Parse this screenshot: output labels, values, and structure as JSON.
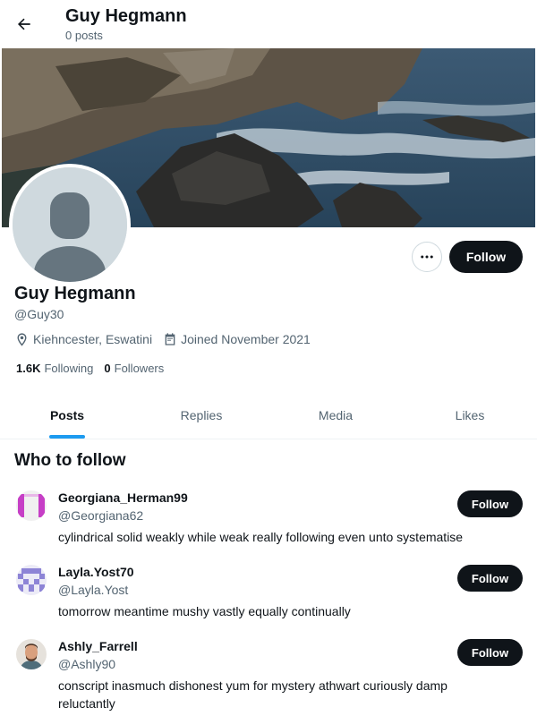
{
  "header": {
    "title": "Guy Hegmann",
    "subtitle": "0 posts"
  },
  "profile": {
    "name": "Guy Hegmann",
    "handle": "@Guy30",
    "location": "Kiehncester, Eswatini",
    "joined": "Joined November 2021",
    "following_count": "1.6K",
    "following_label": "Following",
    "followers_count": "0",
    "followers_label": "Followers",
    "follow_label": "Follow"
  },
  "tabs": [
    {
      "label": "Posts",
      "active": true
    },
    {
      "label": "Replies",
      "active": false
    },
    {
      "label": "Media",
      "active": false
    },
    {
      "label": "Likes",
      "active": false
    }
  ],
  "who_to_follow": {
    "title": "Who to follow",
    "items": [
      {
        "name": "Georgiana_Herman99",
        "handle": "@Georgiana62",
        "bio": "cylindrical solid weakly while weak really following even unto systematise",
        "follow_label": "Follow",
        "avatar": "pattern-avatar-magenta"
      },
      {
        "name": "Layla.Yost70",
        "handle": "@Layla.Yost",
        "bio": "tomorrow meantime mushy vastly equally continually",
        "follow_label": "Follow",
        "avatar": "pattern-avatar-purple"
      },
      {
        "name": "Ashly_Farrell",
        "handle": "@Ashly90",
        "bio": "conscript inasmuch dishonest yum for mystery athwart curiously damp reluctantly",
        "follow_label": "Follow",
        "avatar": "photo-avatar-man"
      }
    ]
  },
  "icons": {
    "back": "arrow-left-icon",
    "more": "more-dots-icon",
    "location": "location-pin-icon",
    "calendar": "calendar-icon"
  },
  "colors": {
    "primary_text": "#0f1419",
    "secondary_text": "#536471",
    "accent": "#1d9bf0",
    "button_bg": "#0f1419"
  }
}
